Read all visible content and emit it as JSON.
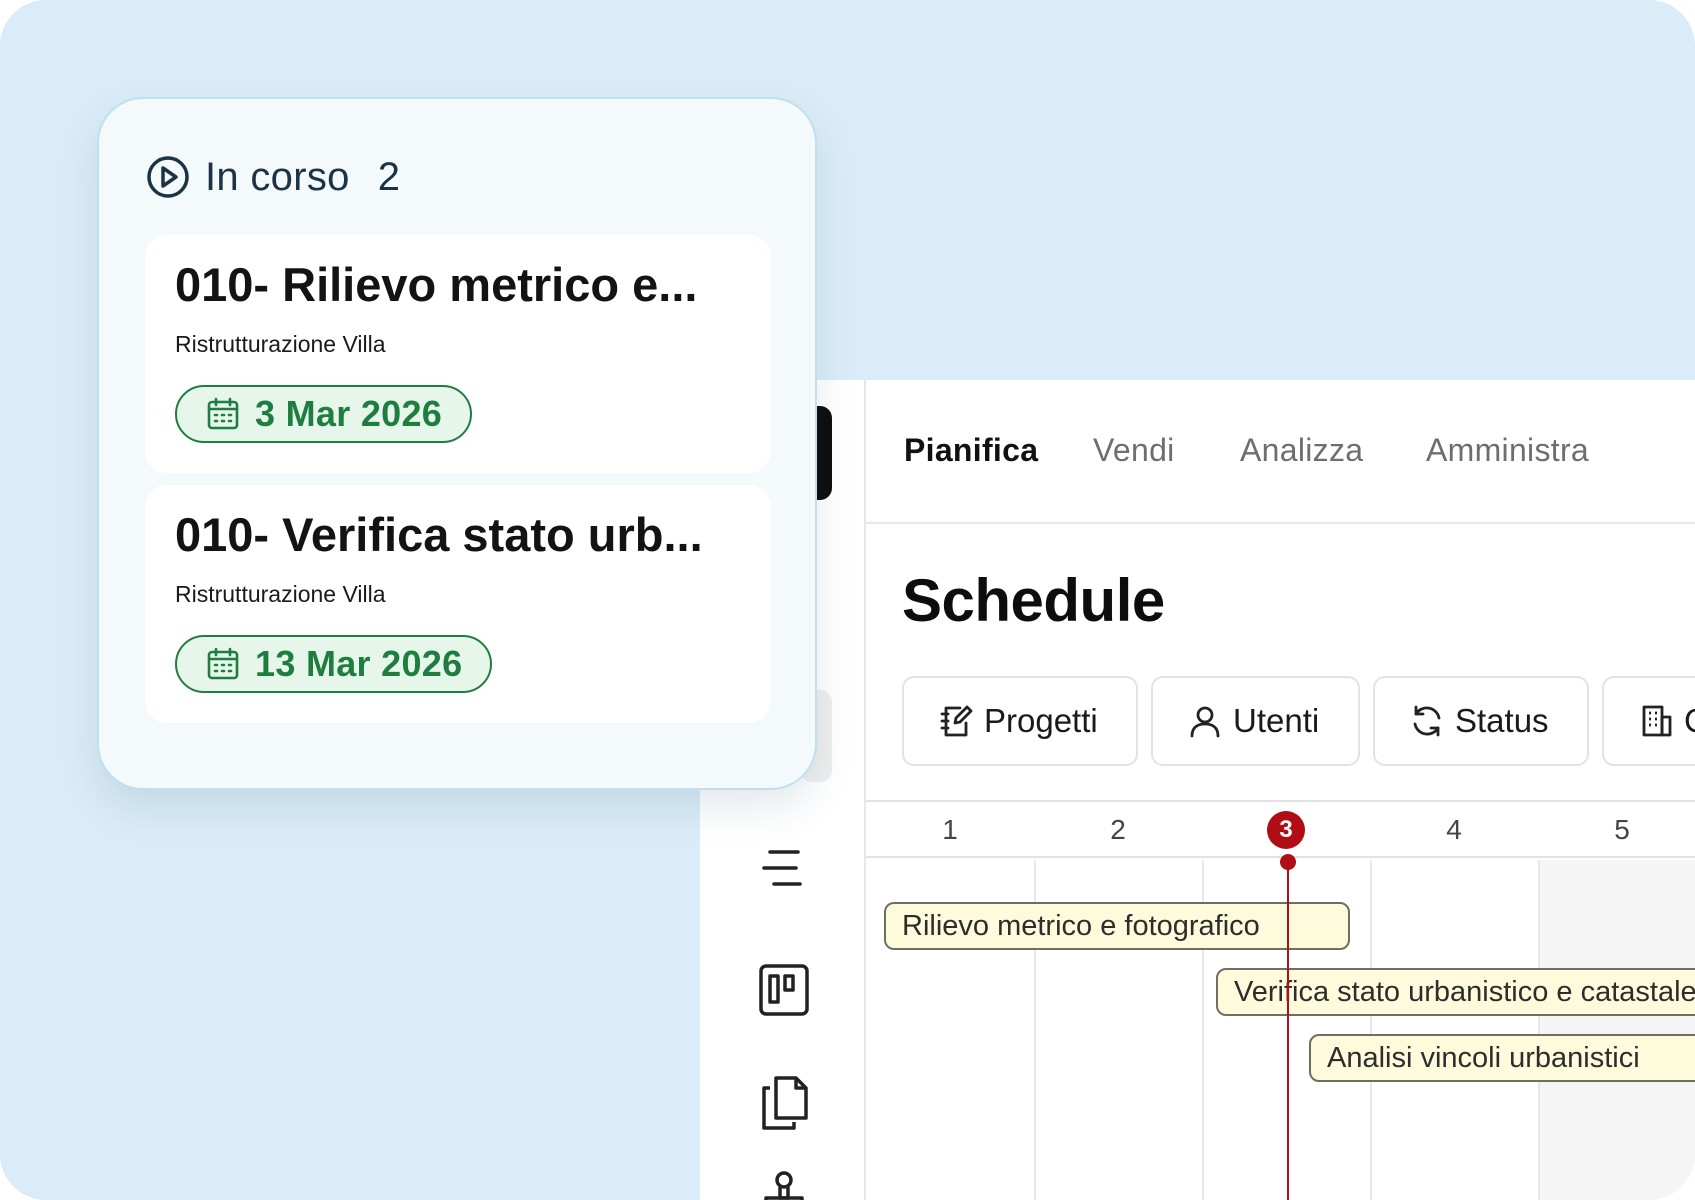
{
  "colors": {
    "background": "#daecf7",
    "today_marker": "#b00d15",
    "date_green": "#1e7d3f",
    "task_bar_fill": "#fdfbdc"
  },
  "card": {
    "status_icon": "play-circle-icon",
    "title": "In corso",
    "count": "2",
    "tasks": [
      {
        "name": "010- Rilievo metrico e...",
        "project": "Ristrutturazione Villa",
        "date": "3 Mar 2026"
      },
      {
        "name": "010- Verifica stato urb...",
        "project": "Ristrutturazione Villa",
        "date": "13 Mar 2026"
      }
    ]
  },
  "nav": {
    "tabs": [
      {
        "label": "Pianifica",
        "active": true
      },
      {
        "label": "Vendi",
        "active": false
      },
      {
        "label": "Analizza",
        "active": false
      },
      {
        "label": "Amministra",
        "active": false
      }
    ]
  },
  "page": {
    "title": "Schedule"
  },
  "filters": [
    {
      "label": "Progetti",
      "icon": "notebook-edit-icon"
    },
    {
      "label": "Utenti",
      "icon": "user-icon"
    },
    {
      "label": "Status",
      "icon": "refresh-icon"
    },
    {
      "label": "C",
      "icon": "building-icon"
    }
  ],
  "sidebar": {
    "icons": [
      "list-align-icon",
      "kanban-board-icon",
      "copy-documents-icon",
      "stamp-icon"
    ]
  },
  "timeline": {
    "days": [
      "1",
      "2",
      "3",
      "4",
      "5"
    ],
    "today": "3",
    "tasks": [
      {
        "label": "Rilievo metrico e fotografico"
      },
      {
        "label": "Verifica stato urbanistico e catastale"
      },
      {
        "label": "Analisi vincoli urbanistici"
      }
    ]
  }
}
